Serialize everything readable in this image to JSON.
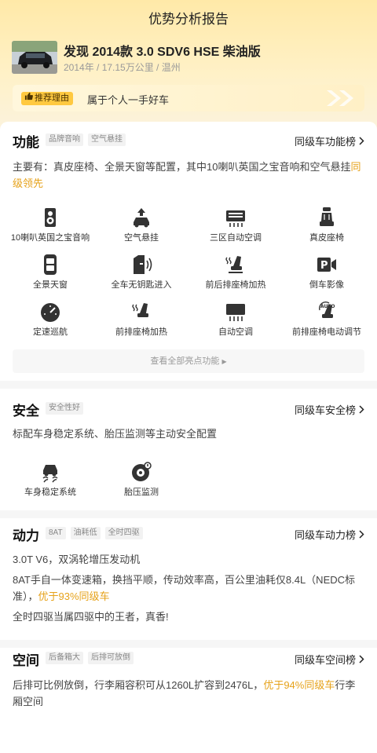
{
  "header": {
    "title": "优势分析报告"
  },
  "car": {
    "name": "发现 2014款 3.0 SDV6 HSE 柴油版",
    "meta": "2014年 / 17.15万公里 / 温州"
  },
  "reason": {
    "badge": "推荐理由",
    "text": "属于个人一手好车"
  },
  "function": {
    "title": "功能",
    "tags": [
      "品牌音响",
      "空气悬挂"
    ],
    "rank_link": "同级车功能榜",
    "desc": "主要有：真皮座椅、全景天窗等配置，其中10喇叭英国之宝音响和空气悬挂",
    "desc_highlight": "同级领先",
    "features": [
      {
        "label": "10喇叭英国之宝音响",
        "icon": "speaker-icon"
      },
      {
        "label": "空气悬挂",
        "icon": "air-suspension-icon"
      },
      {
        "label": "三区自动空调",
        "icon": "climate-zones-icon"
      },
      {
        "label": "真皮座椅",
        "icon": "leather-seat-icon"
      },
      {
        "label": "全景天窗",
        "icon": "panoramic-sunroof-icon"
      },
      {
        "label": "全车无钥匙进入",
        "icon": "keyless-entry-icon"
      },
      {
        "label": "前后排座椅加热",
        "icon": "seat-heating-front-rear-icon"
      },
      {
        "label": "倒车影像",
        "icon": "reverse-camera-icon"
      },
      {
        "label": "定速巡航",
        "icon": "cruise-control-icon"
      },
      {
        "label": "前排座椅加热",
        "icon": "front-seat-heating-icon"
      },
      {
        "label": "自动空调",
        "icon": "auto-ac-icon"
      },
      {
        "label": "前排座椅电动调节",
        "icon": "power-seat-icon"
      }
    ],
    "view_all": "查看全部亮点功能"
  },
  "safety": {
    "title": "安全",
    "tags": [
      "安全性好"
    ],
    "rank_link": "同级车安全榜",
    "desc": "标配车身稳定系统、胎压监测等主动安全配置",
    "features": [
      {
        "label": "车身稳定系统",
        "icon": "stability-control-icon"
      },
      {
        "label": "胎压监测",
        "icon": "tire-pressure-icon"
      }
    ]
  },
  "power": {
    "title": "动力",
    "tags": [
      "8AT",
      "油耗低",
      "全时四驱"
    ],
    "rank_link": "同级车动力榜",
    "line1": "3.0T V6，双涡轮增压发动机",
    "line2": "8AT手自一体变速箱，换挡平顺，传动效率高，百公里油耗仅8.4L（NEDC标准），",
    "line2_highlight": "优于93%同级车",
    "line3": "全时四驱当属四驱中的王者，真香!"
  },
  "space": {
    "title": "空间",
    "tags": [
      "后备箱大",
      "后排可放倒"
    ],
    "rank_link": "同级车空间榜",
    "desc": "后排可比例放倒，行李厢容积可从1260L扩容到2476L，",
    "desc_highlight": "优于94%同级车",
    "desc_tail": "行李厢空间"
  },
  "colors": {
    "accent": "#e6a21a",
    "badge": "#ffc940",
    "header_bg": "#ffe9a8"
  }
}
